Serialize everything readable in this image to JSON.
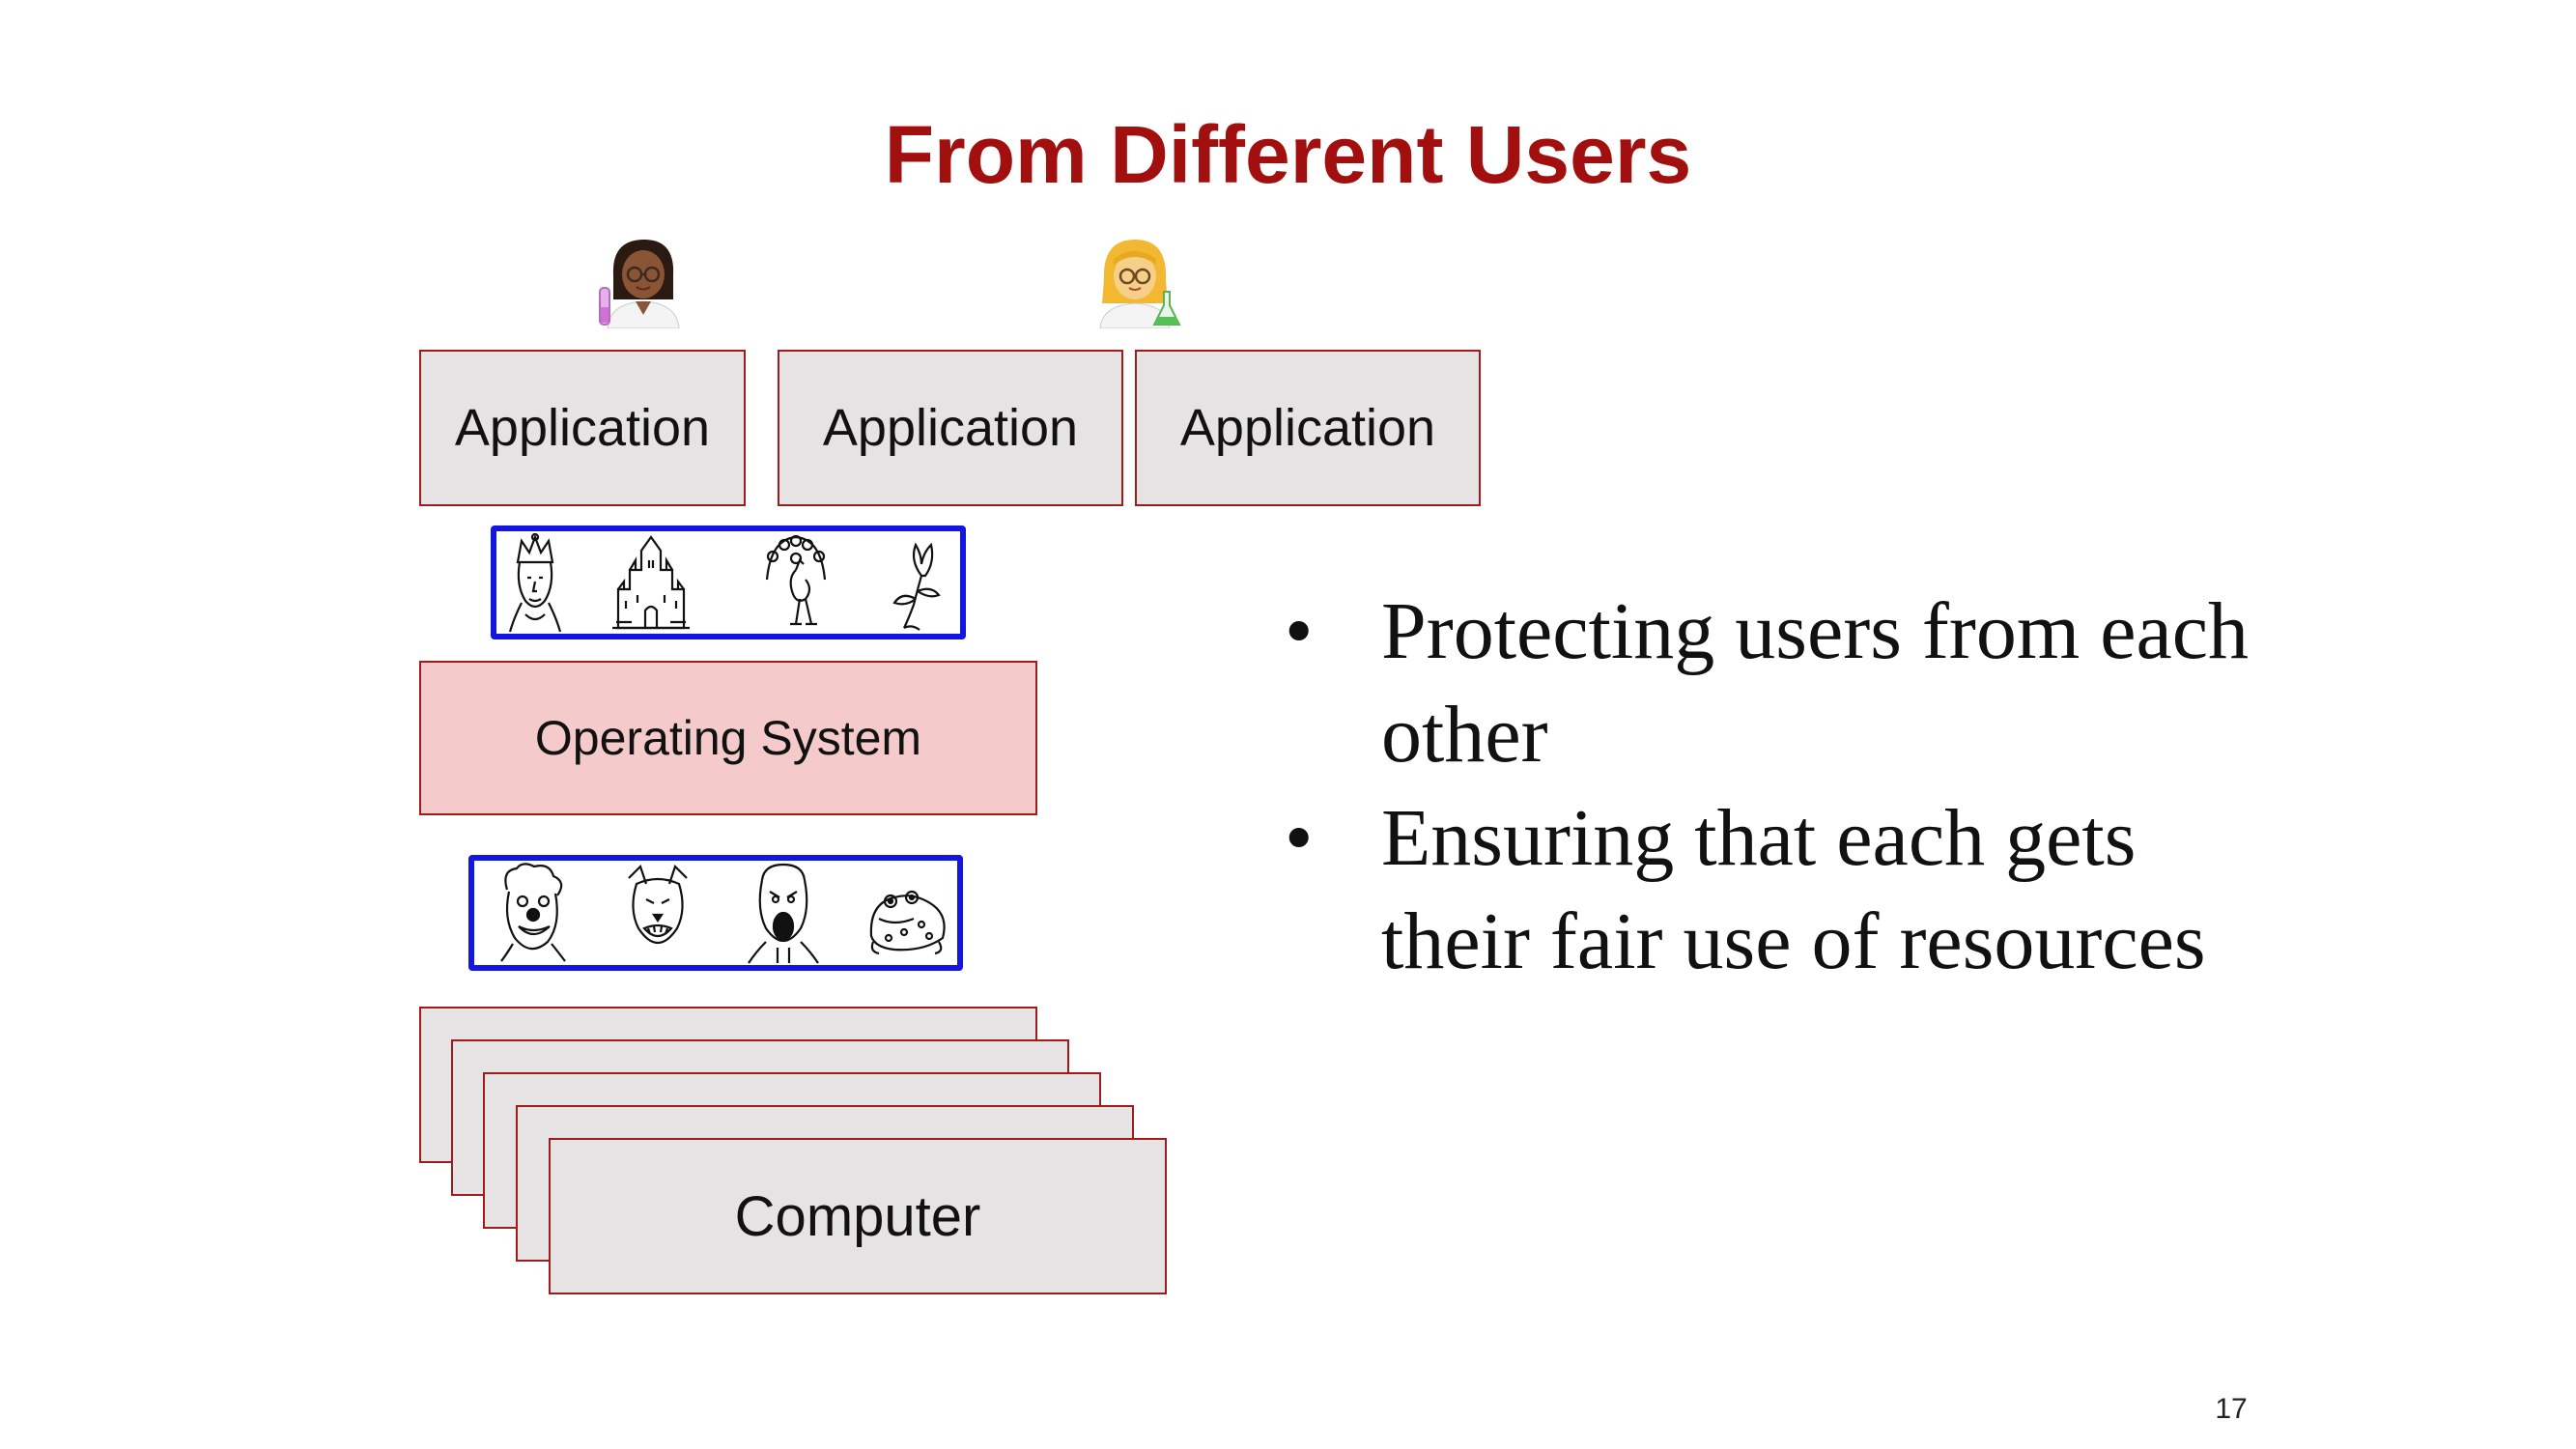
{
  "slide": {
    "title": "From Different Users",
    "page_number": "17"
  },
  "stack": {
    "applications": [
      "Application",
      "Application",
      "Application"
    ],
    "operating_system": "Operating System",
    "computer": "Computer"
  },
  "bullets": [
    "Protecting users from each other",
    "Ensuring that each gets their fair use of resources"
  ],
  "icons": {
    "users": [
      "scientist-woman-dark-icon",
      "scientist-woman-blond-icon"
    ],
    "protected_row": [
      "queen-drawing-icon",
      "castle-drawing-icon",
      "peacock-drawing-icon",
      "flower-drawing-icon"
    ],
    "attacker_row": [
      "clown-face-drawing-icon",
      "snarling-dog-drawing-icon",
      "screaming-man-drawing-icon",
      "toad-drawing-icon"
    ]
  },
  "colors": {
    "title": "#a10f0f",
    "box_border": "#a01c1c",
    "box_fill": "#e5e3e4",
    "os_fill": "#f4cacb",
    "frame_border": "#1515e0"
  }
}
